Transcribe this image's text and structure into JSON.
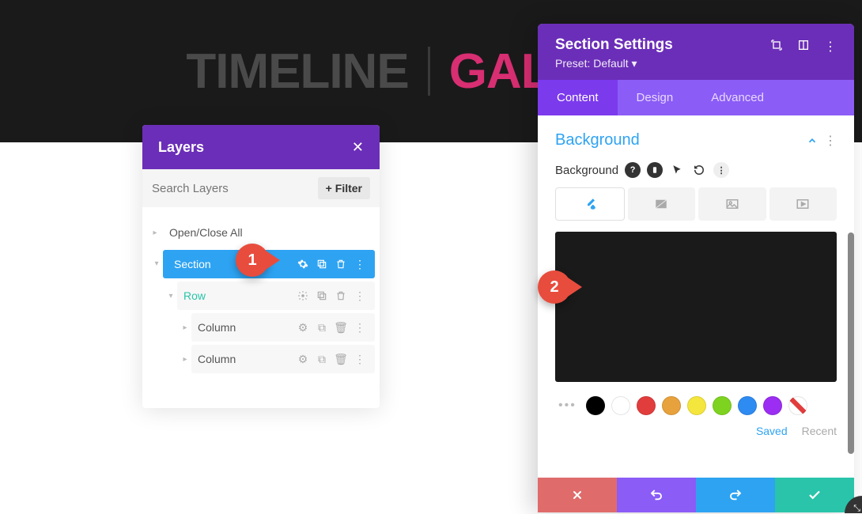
{
  "hero": {
    "timeline": "TIMELINE",
    "gallery": "GALLERY"
  },
  "layers": {
    "title": "Layers",
    "search_placeholder": "Search Layers",
    "filter_label": "Filter",
    "open_close": "Open/Close All",
    "items": {
      "section": "Section",
      "row": "Row",
      "columns": [
        "Column",
        "Column"
      ]
    }
  },
  "settings": {
    "title": "Section Settings",
    "preset": "Preset: Default",
    "tabs": {
      "content": "Content",
      "design": "Design",
      "advanced": "Advanced"
    },
    "background": {
      "title": "Background",
      "label": "Background",
      "preview_color": "#1a1a1a",
      "swatches": [
        "#000000",
        "#ffffff",
        "#e23d3d",
        "#e8a23d",
        "#f5e63d",
        "#7ed321",
        "#2e8bf2",
        "#9b2ef2"
      ],
      "saved": "Saved",
      "recent": "Recent"
    }
  },
  "callouts": {
    "one": "1",
    "two": "2"
  }
}
